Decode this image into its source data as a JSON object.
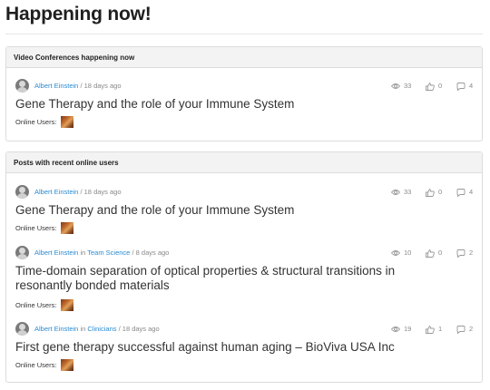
{
  "page_title": "Happening now!",
  "sections": {
    "video": {
      "heading": "Video Conferences happening now"
    },
    "posts": {
      "heading": "Posts with recent online users"
    }
  },
  "posts": [
    {
      "author": "Albert Einstein",
      "in_text": "",
      "category": "",
      "time": "18 days ago",
      "title": "Gene Therapy and the role of your Immune System",
      "views": "33",
      "likes": "0",
      "comments": "4",
      "online_label": "Online Users:"
    },
    {
      "author": "Albert Einstein",
      "in_text": "",
      "category": "",
      "time": "18 days ago",
      "title": "Gene Therapy and the role of your Immune System",
      "views": "33",
      "likes": "0",
      "comments": "4",
      "online_label": "Online Users:"
    },
    {
      "author": "Albert Einstein",
      "in_text": "in",
      "category": "Team Science",
      "time": "8 days ago",
      "title": "Time-domain separation of optical properties & structural transitions in resonantly bonded materials",
      "views": "10",
      "likes": "0",
      "comments": "2",
      "online_label": "Online Users:"
    },
    {
      "author": "Albert Einstein",
      "in_text": "in",
      "category": "Clinicians",
      "time": "18 days ago",
      "title": "First gene therapy successful against human aging – BioViva USA Inc",
      "views": "19",
      "likes": "1",
      "comments": "2",
      "online_label": "Online Users:"
    }
  ],
  "separator": "/",
  "icons": {
    "views": "eye-icon",
    "likes": "thumbs-up-icon",
    "comments": "comment-icon"
  },
  "colors": {
    "link": "#2a8bd2",
    "panel_header_bg": "#f3f3f3"
  }
}
